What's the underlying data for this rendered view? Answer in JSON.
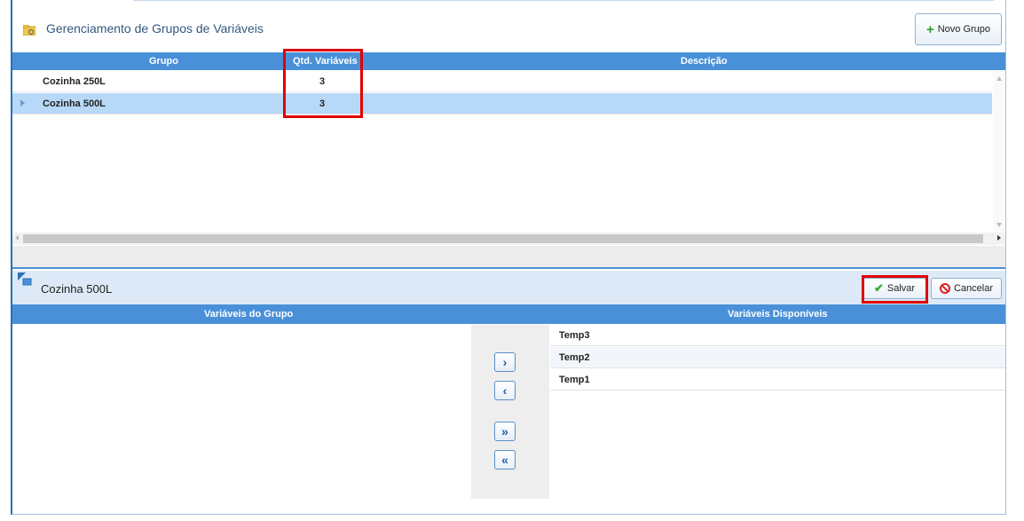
{
  "header": {
    "title": "Gerenciamento de Grupos de Variáveis",
    "new_group_label": "Novo Grupo"
  },
  "grid": {
    "columns": [
      "Grupo",
      "Qtd. Variáveis",
      "Descrição"
    ],
    "rows": [
      {
        "grupo": "Cozinha 250L",
        "qtd": "3",
        "descricao": "",
        "selected": false
      },
      {
        "grupo": "Cozinha 500L",
        "qtd": "3",
        "descricao": "",
        "selected": true
      }
    ]
  },
  "detail": {
    "title": "Cozinha 500L",
    "save_label": "Salvar",
    "cancel_label": "Cancelar",
    "left_header": "Variáveis do Grupo",
    "right_header": "Variáveis Disponíveis",
    "available": [
      "Temp3",
      "Temp2",
      "Temp1"
    ],
    "move_buttons": {
      "add": "›",
      "remove": "‹",
      "add_all": "»",
      "remove_all": "«"
    }
  },
  "colors": {
    "accent": "#4a90d9",
    "selected_row": "#b7d9f7",
    "highlight": "#e00000"
  }
}
